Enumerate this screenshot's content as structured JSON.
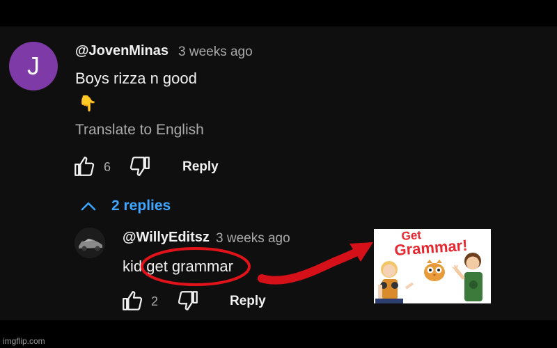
{
  "comment": {
    "avatar_letter": "J",
    "avatar_color": "#7e3aa6",
    "handle": "@JovenMinas",
    "time": "3 weeks ago",
    "text": "Boys rizza n good",
    "emoji": "👇",
    "translate": "Translate to English",
    "likes": "6",
    "reply_label": "Reply"
  },
  "replies_toggle": {
    "label": "2 replies",
    "color": "#3ea6ff"
  },
  "reply": {
    "handle": "@WillyEditsz",
    "time": "3 weeks ago",
    "text": "kid get grammar",
    "likes": "2",
    "reply_label": "Reply"
  },
  "poster": {
    "line1": "Get",
    "line2": "Grammar!",
    "title_color": "#e8262f"
  },
  "annotation": {
    "color": "#e0131b"
  },
  "watermark": "imgflip.com"
}
